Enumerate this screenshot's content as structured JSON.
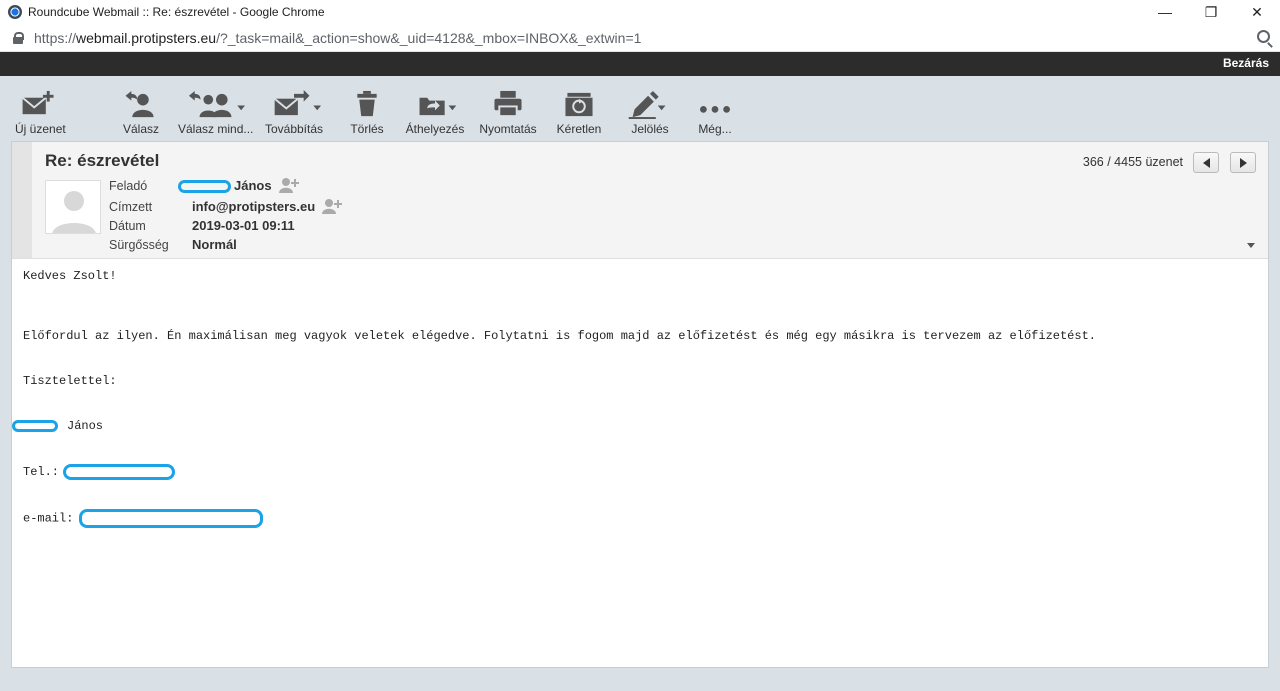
{
  "window": {
    "title": "Roundcube Webmail :: Re: észrevétel - Google Chrome",
    "controls": {
      "minimize": "—",
      "restore": "❐",
      "close": "✕"
    }
  },
  "address": {
    "scheme": "https://",
    "host": "webmail.protipsters.eu",
    "path": "/?_task=mail&_action=show&_uid=4128&_mbox=INBOX&_extwin=1"
  },
  "topbar": {
    "close_label": "Bezárás"
  },
  "toolbar": {
    "compose": "Új üzenet",
    "reply": "Válasz",
    "reply_all": "Válasz mind...",
    "forward": "Továbbítás",
    "delete": "Törlés",
    "move": "Áthelyezés",
    "print": "Nyomtatás",
    "archive": "Kéretlen",
    "mark": "Jelölés",
    "more": "Még..."
  },
  "message": {
    "subject": "Re: észrevétel",
    "counter": "366 / 4455 üzenet",
    "from_label": "Feladó",
    "from_name": "János",
    "to_label": "Címzett",
    "to_value": "info@protipsters.eu",
    "date_label": "Dátum",
    "date_value": "2019-03-01 09:11",
    "priority_label": "Sürgősség",
    "priority_value": "Normál"
  },
  "body": {
    "greeting": "Kedves Zsolt!",
    "paragraph": "Előfordul az ilyen. Én maximálisan meg vagyok veletek elégedve. Folytatni is fogom majd az előfizetést és még egy másikra is tervezem az előfizetést.",
    "closing": "Tisztelettel:",
    "signature_name": "János",
    "tel_label": "Tel.:",
    "email_label": "e-mail:"
  },
  "colors": {
    "redaction": "#1aa3e6",
    "toolbar_bg": "#d9e0e6",
    "topbar_bg": "#2c2c2c"
  }
}
